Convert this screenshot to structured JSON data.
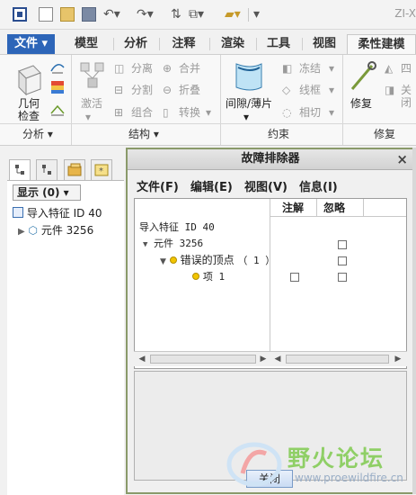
{
  "app_title": "ZI-X",
  "ribbon_tabs": [
    {
      "label": "文件 ▾"
    },
    {
      "label": "模型"
    },
    {
      "label": "分析"
    },
    {
      "label": "注释"
    },
    {
      "label": "渲染"
    },
    {
      "label": "工具"
    },
    {
      "label": "视图"
    },
    {
      "label": "柔性建模"
    }
  ],
  "ribbon": {
    "geom_check": "几何\n检查",
    "activate": "激活",
    "separate": "分离",
    "split": "分割",
    "group": "组合",
    "merge": "合并",
    "fold": "折叠",
    "convert": "转换",
    "gap_sheet": "间隙/薄片",
    "freeze": "冻结",
    "wireframe": "线框",
    "tangent": "相切",
    "repair": "修复",
    "four": "四",
    "close": "关闭"
  },
  "ribbon_groups": {
    "analysis": "分析 ▾",
    "structure": "结构 ▾",
    "constraint": "约束",
    "repair": "修复"
  },
  "tree": {
    "show_button": "显示 (0) ▾",
    "rows": [
      {
        "label": "导入特征 ID 40"
      },
      {
        "label": "元件 3256"
      }
    ]
  },
  "dialog": {
    "title": "故障排除器",
    "close_symbol": "×",
    "menus": [
      "文件(F)",
      "编辑(E)",
      "视图(V)",
      "信息(I)"
    ],
    "columns": {
      "annotate": "注解",
      "ignore": "忽略"
    },
    "rows": [
      {
        "label": "导入特征 ID 40"
      },
      {
        "label": "元件 3256"
      },
      {
        "label": "错误的顶点",
        "count": "（ 1 ）"
      },
      {
        "label": "项 1"
      }
    ],
    "close_button": "关闭"
  },
  "watermark": {
    "title": "野火论坛",
    "url": "www.proewildfire.cn"
  },
  "colors": {
    "accent": "#2d65b8",
    "dialog_border": "#8a9a6a",
    "warning_dot": "#f2c500"
  }
}
